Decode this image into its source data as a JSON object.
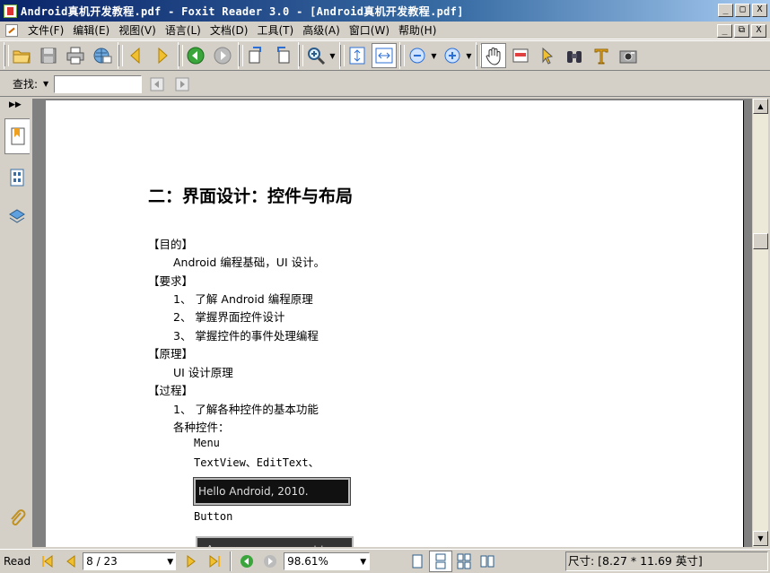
{
  "window": {
    "title": "Android真机开发教程.pdf - Foxit Reader 3.0 - [Android真机开发教程.pdf]",
    "btn_min": "_",
    "btn_max": "□",
    "btn_close": "X",
    "btn_restore": "⧉"
  },
  "menu": [
    "文件(F)",
    "编辑(E)",
    "视图(V)",
    "语言(L)",
    "文档(D)",
    "工具(T)",
    "高级(A)",
    "窗口(W)",
    "帮助(H)"
  ],
  "find": {
    "label": "查找:",
    "value": "",
    "placeholder": ""
  },
  "document": {
    "heading": "二：界面设计：控件与布局",
    "lines": [
      {
        "text": "【目的】",
        "indent": 0
      },
      {
        "text": "Android 编程基础，UI 设计。",
        "indent": 1
      },
      {
        "text": "【要求】",
        "indent": 0
      },
      {
        "text": "1、 了解 Android 编程原理",
        "indent": 1
      },
      {
        "text": "2、 掌握界面控件设计",
        "indent": 1
      },
      {
        "text": "3、 掌握控件的事件处理编程",
        "indent": 1
      },
      {
        "text": "【原理】",
        "indent": 0
      },
      {
        "text": "UI 设计原理",
        "indent": 1
      },
      {
        "text": "【过程】",
        "indent": 0
      },
      {
        "text": "1、 了解各种控件的基本功能",
        "indent": 1
      },
      {
        "text": "各种控件：",
        "indent": 1
      },
      {
        "text": "Menu",
        "indent": 2
      },
      {
        "text": "TextView、EditText、",
        "indent": 2
      },
      {
        "text": "Button",
        "indent": 2
      }
    ],
    "sample_text": "Hello Android, 2010.",
    "sample_dialog": "Are you sure you want to exit?"
  },
  "status": {
    "mode": "Read",
    "page": "8 / 23",
    "zoom": "98.61%",
    "size": "尺寸: [8.27 * 11.69 英寸]"
  },
  "colors": {
    "title_start": "#0a246a",
    "title_end": "#a6caf0",
    "chrome": "#d4d0c8",
    "doc_bg": "#808080"
  }
}
